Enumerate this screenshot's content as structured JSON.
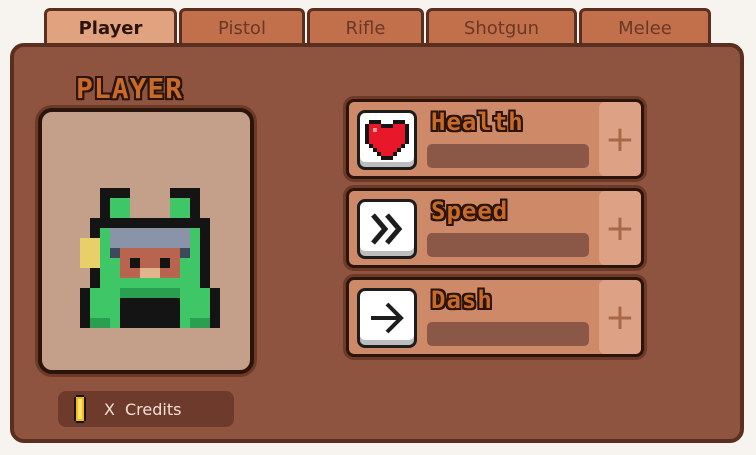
{
  "tabs": [
    {
      "label": "Player",
      "active": true
    },
    {
      "label": "Pistol",
      "active": false
    },
    {
      "label": "Rifle",
      "active": false
    },
    {
      "label": "Shotgun",
      "active": false
    },
    {
      "label": "Melee",
      "active": false
    }
  ],
  "player": {
    "title": "PLAYER",
    "credits_amount": "X",
    "credits_label": "Credits"
  },
  "stats": [
    {
      "label": "Health",
      "icon": "heart-icon",
      "level": 0,
      "upgrade_label": "+"
    },
    {
      "label": "Speed",
      "icon": "fast-forward-icon",
      "level": 0,
      "upgrade_label": "+"
    },
    {
      "label": "Dash",
      "icon": "arrow-right-icon",
      "level": 0,
      "upgrade_label": "+"
    }
  ],
  "colors": {
    "tab_active": "#e1a27f",
    "tab_inactive": "#c26f4b",
    "panel": "#8e5440",
    "portrait_bg": "#c4a08a",
    "stat_card": "#ce8a68",
    "title_orange": "#c86b2a",
    "heart_red": "#e8182a",
    "character_green": "#3fc767"
  }
}
